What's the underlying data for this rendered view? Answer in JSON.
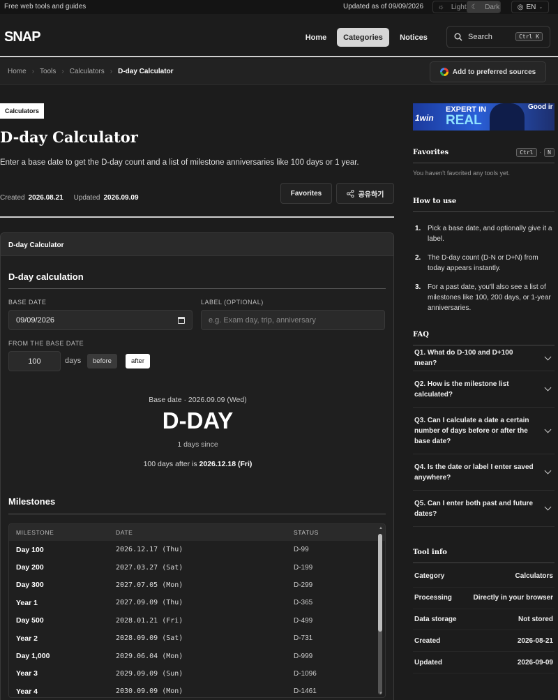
{
  "topbar": {
    "tagline": "Free web tools and guides",
    "updated": "Updated as of 09/09/2026",
    "theme_light": "Light",
    "theme_dark": "Dark",
    "language": "EN"
  },
  "header": {
    "logo": "SNAP",
    "nav": [
      "Home",
      "Categories",
      "Notices"
    ],
    "search_label": "Search",
    "search_shortcut": "Ctrl K"
  },
  "breadcrumb": {
    "items": [
      "Home",
      "Tools",
      "Calculators",
      "D-day Calculator"
    ],
    "preferred_sources": "Add to preferred sources"
  },
  "page": {
    "category_badge": "Calculators",
    "title": "D-day Calculator",
    "description": "Enter a base date to get the D-day count and a list of milestone anniversaries like 100 days or 1 year.",
    "created_label": "Created",
    "created_value": "2026.08.21",
    "updated_label": "Updated",
    "updated_value": "2026.09.09",
    "favorites_button": "Favorites",
    "share_button": "공유하기"
  },
  "calculator": {
    "card_title": "D-day Calculator",
    "section_title": "D-day calculation",
    "base_date_label": "BASE DATE",
    "base_date_value": "09/09/2026",
    "label_label": "LABEL (OPTIONAL)",
    "label_placeholder": "e.g. Exam day, trip, anniversary",
    "from_label": "FROM THE BASE DATE",
    "days_value": "100",
    "days_unit": "days",
    "before": "before",
    "after": "after",
    "result_base": "Base date · 2026.09.09 (Wed)",
    "result_big": "D-DAY",
    "result_since": "1 days since",
    "result_after_prefix": "100 days after is",
    "result_after_date": "2026.12.18 (Fri)"
  },
  "milestones": {
    "title": "Milestones",
    "headers": [
      "MILESTONE",
      "DATE",
      "STATUS"
    ],
    "rows": [
      {
        "milestone": "Day 100",
        "date": "2026.12.17 (Thu)",
        "status": "D-99"
      },
      {
        "milestone": "Day 200",
        "date": "2027.03.27 (Sat)",
        "status": "D-199"
      },
      {
        "milestone": "Day 300",
        "date": "2027.07.05 (Mon)",
        "status": "D-299"
      },
      {
        "milestone": "Year 1",
        "date": "2027.09.09 (Thu)",
        "status": "D-365"
      },
      {
        "milestone": "Day 500",
        "date": "2028.01.21 (Fri)",
        "status": "D-499"
      },
      {
        "milestone": "Year 2",
        "date": "2028.09.09 (Sat)",
        "status": "D-731"
      },
      {
        "milestone": "Day 1,000",
        "date": "2029.06.04 (Mon)",
        "status": "D-999"
      },
      {
        "milestone": "Year 3",
        "date": "2029.09.09 (Sun)",
        "status": "D-1096"
      },
      {
        "milestone": "Year 4",
        "date": "2030.09.09 (Mon)",
        "status": "D-1461"
      }
    ]
  },
  "sidebar": {
    "ad_text_1": "EXPERT IN",
    "ad_text_2": "REAL",
    "ad_brand": "1win",
    "ad_good": "Good ir",
    "favorites_title": "Favorites",
    "favorites_kbd_1": "Ctrl",
    "favorites_kbd_sep": "·",
    "favorites_kbd_2": "N",
    "favorites_empty": "You haven't favorited any tools yet.",
    "howto_title": "How to use",
    "howto": [
      {
        "n": "1.",
        "text": "Pick a base date, and optionally give it a label."
      },
      {
        "n": "2.",
        "text": "The D-day count (D-N or D+N) from today appears instantly."
      },
      {
        "n": "3.",
        "text": "For a past date, you'll also see a list of milestones like 100, 200 days, or 1-year anniversaries."
      }
    ],
    "faq_title": "FAQ",
    "faq": [
      "Q1. What do D-100 and D+100 mean?",
      "Q2. How is the milestone list calculated?",
      "Q3. Can I calculate a date a certain number of days before or after the base date?",
      "Q4. Is the date or label I enter saved anywhere?",
      "Q5. Can I enter both past and future dates?"
    ],
    "toolinfo_title": "Tool info",
    "toolinfo": [
      {
        "k": "Category",
        "v": "Calculators"
      },
      {
        "k": "Processing",
        "v": "Directly in your browser"
      },
      {
        "k": "Data storage",
        "v": "Not stored"
      },
      {
        "k": "Created",
        "v": "2026-08-21"
      },
      {
        "k": "Updated",
        "v": "2026-09-09"
      }
    ]
  },
  "colors": {
    "background": "#1c1c1c",
    "accent_active": "#d6d6d6",
    "text_primary": "#ffffff"
  }
}
